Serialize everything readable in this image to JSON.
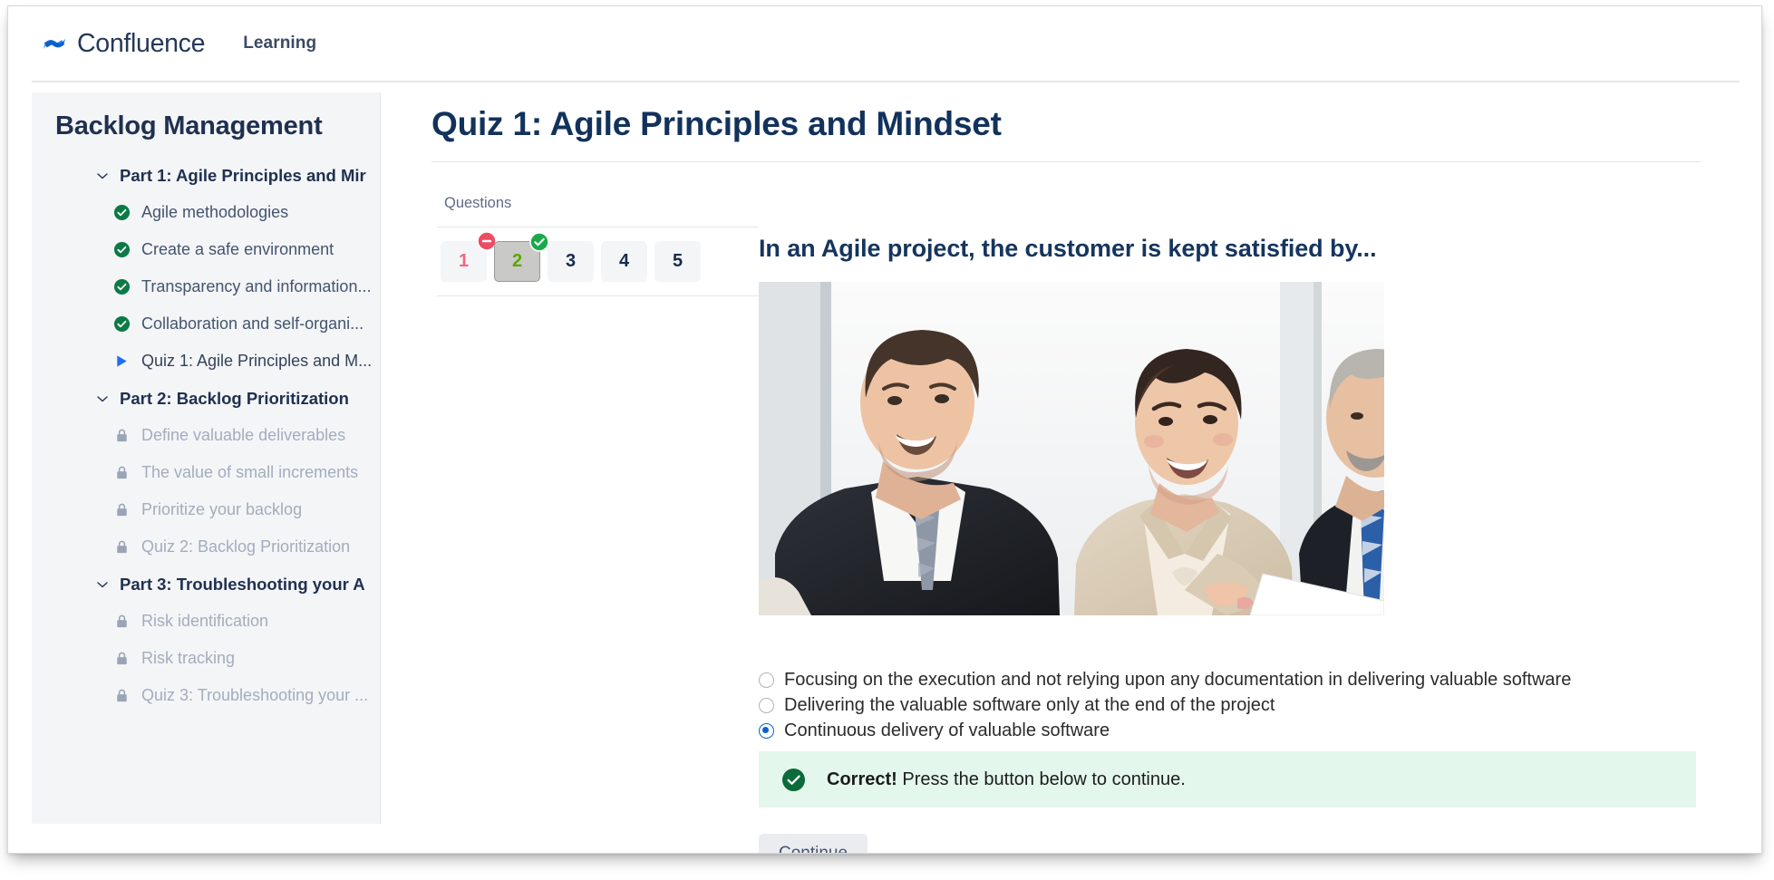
{
  "header": {
    "brand_name": "Confluence",
    "brand_logo_icon": "confluence-logo-icon",
    "nav_learning": "Learning"
  },
  "sidebar": {
    "title": "Backlog Management",
    "items": [
      {
        "label": "Part 1: Agile Principles and Mir",
        "type": "section",
        "icon": "chevron-down-icon"
      },
      {
        "label": "Agile methodologies",
        "type": "lesson",
        "icon": "check-circle-icon",
        "state": "complete"
      },
      {
        "label": "Create a safe environment",
        "type": "lesson",
        "icon": "check-circle-icon",
        "state": "complete"
      },
      {
        "label": "Transparency and information...",
        "type": "lesson",
        "icon": "check-circle-icon",
        "state": "complete"
      },
      {
        "label": "Collaboration and self-organi...",
        "type": "lesson",
        "icon": "check-circle-icon",
        "state": "complete"
      },
      {
        "label": "Quiz 1: Agile Principles and M...",
        "type": "lesson",
        "icon": "play-triangle-icon",
        "state": "current"
      },
      {
        "label": "Part 2: Backlog Prioritization",
        "type": "section",
        "icon": "chevron-down-icon"
      },
      {
        "label": "Define valuable deliverables",
        "type": "lesson",
        "icon": "lock-icon",
        "state": "locked"
      },
      {
        "label": "The value of small increments",
        "type": "lesson",
        "icon": "lock-icon",
        "state": "locked"
      },
      {
        "label": "Prioritize your backlog",
        "type": "lesson",
        "icon": "lock-icon",
        "state": "locked"
      },
      {
        "label": "Quiz 2: Backlog Prioritization",
        "type": "lesson",
        "icon": "lock-icon",
        "state": "locked"
      },
      {
        "label": "Part 3: Troubleshooting your A",
        "type": "section",
        "icon": "chevron-down-icon"
      },
      {
        "label": "Risk identification",
        "type": "lesson",
        "icon": "lock-icon",
        "state": "locked"
      },
      {
        "label": "Risk tracking",
        "type": "lesson",
        "icon": "lock-icon",
        "state": "locked"
      },
      {
        "label": "Quiz 3: Troubleshooting your ...",
        "type": "lesson",
        "icon": "lock-icon",
        "state": "locked"
      }
    ]
  },
  "main": {
    "page_title": "Quiz 1: Agile Principles and Mindset",
    "questions_caption": "Questions",
    "question_buttons": [
      {
        "label": "1",
        "state": "incorrect",
        "badge": "minus-circle-icon",
        "selected": false
      },
      {
        "label": "2",
        "state": "correct",
        "badge": "check-circle-icon",
        "selected": true
      },
      {
        "label": "3",
        "state": "unanswered",
        "badge": null,
        "selected": false
      },
      {
        "label": "4",
        "state": "unanswered",
        "badge": null,
        "selected": false
      },
      {
        "label": "5",
        "state": "unanswered",
        "badge": null,
        "selected": false
      }
    ],
    "question_text": "In an Agile project, the customer is kept satisfied by...",
    "question_image_alt": "business-meeting-photo",
    "answers": [
      {
        "label": "Focusing on the execution and not relying upon any documentation in delivering valuable software",
        "checked": false
      },
      {
        "label": "Delivering the valuable software only at the end of the project",
        "checked": false
      },
      {
        "label": "Continuous delivery of valuable software",
        "checked": true
      }
    ],
    "feedback": {
      "icon": "check-circle-icon",
      "bold": "Correct!",
      "text": " Press the button below to continue."
    },
    "continue_label": "Continue"
  },
  "colors": {
    "brand_blue": "#2681ff",
    "sidebar_bg": "#f4f5f7",
    "heading_navy": "#12325c",
    "success_green": "#0b7a45",
    "error_red": "#ef4b62",
    "radio_blue": "#0a62d0",
    "feedback_bg": "#e4f7ec"
  }
}
